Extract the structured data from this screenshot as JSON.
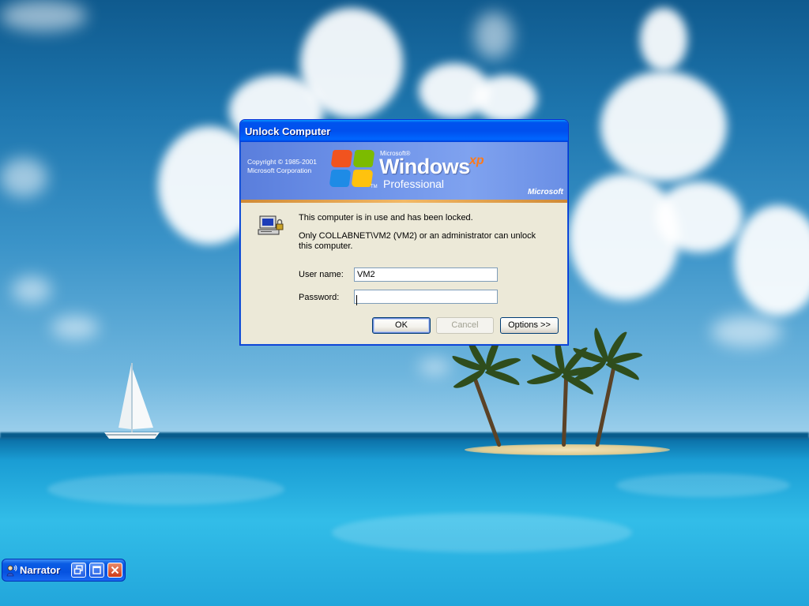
{
  "dialog": {
    "title": "Unlock Computer",
    "banner": {
      "copyright_line1": "Copyright © 1985-2001",
      "copyright_line2": "Microsoft Corporation",
      "brand_small": "Microsoft®",
      "product": "Windows",
      "version": "xp",
      "edition": "Professional",
      "tm": "TM",
      "company_logo": "Microsoft"
    },
    "message_line1": "This computer is in use and has been locked.",
    "message_line2": "Only COLLABNET\\VM2 (VM2) or an administrator can unlock this computer.",
    "username_label": "User name:",
    "username_value": "VM2",
    "password_label": "Password:",
    "password_value": "",
    "ok_label": "OK",
    "cancel_label": "Cancel",
    "options_label": "Options >>"
  },
  "narrator": {
    "title": "Narrator"
  },
  "icons": [
    "lock-computer-icon",
    "windows-flag-icon",
    "narrator-icon",
    "restore-icon",
    "maximize-icon",
    "close-icon"
  ],
  "colors": {
    "title_blue": "#0053ee",
    "dialog_bg": "#ece9d8",
    "banner_blue": "#6f94ea",
    "accent_orange": "#f2b866",
    "xp_orange": "#ff7a1a",
    "close_red": "#cf3a18"
  }
}
